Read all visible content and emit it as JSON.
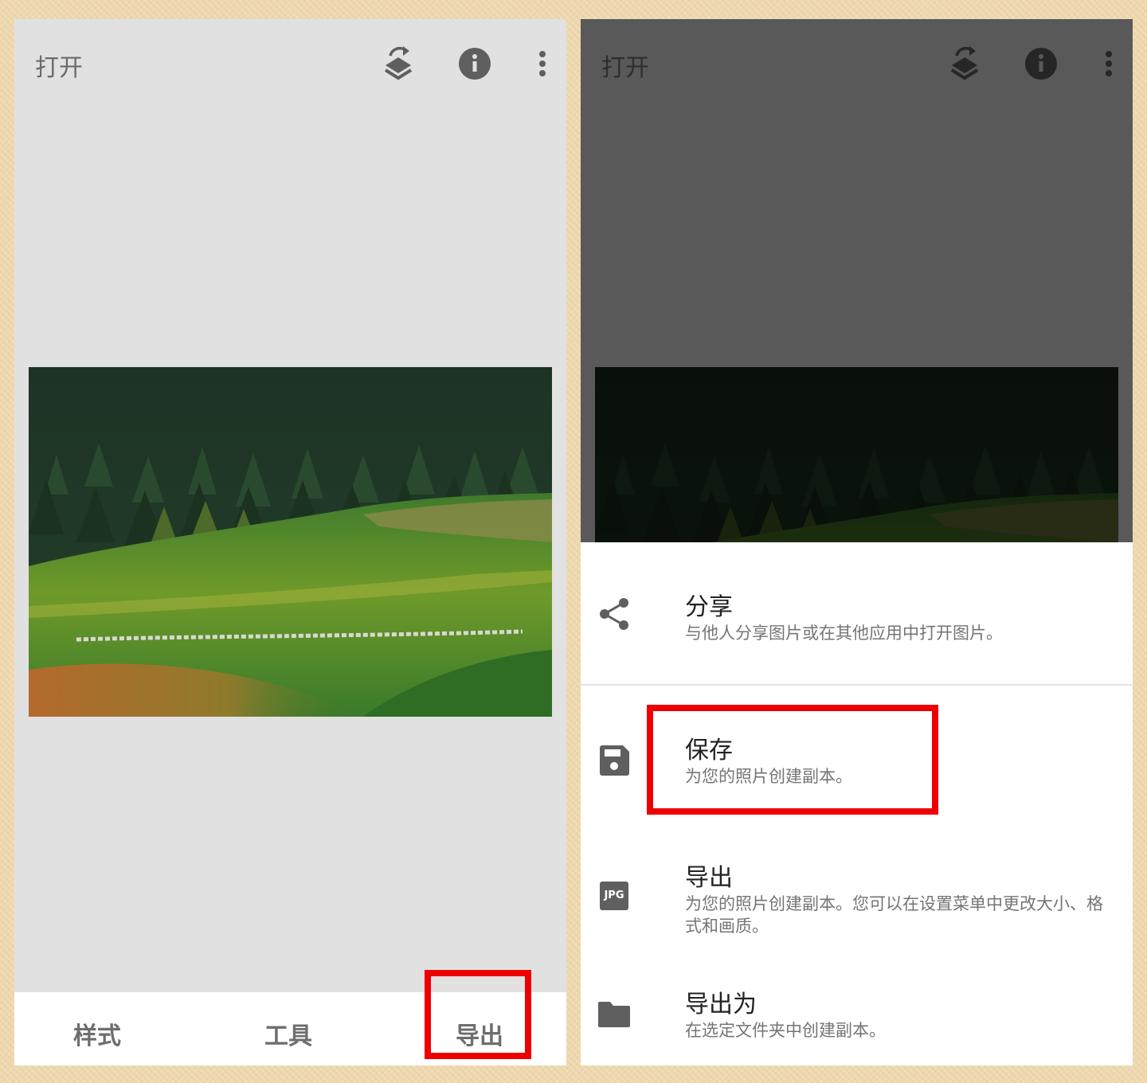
{
  "left_screen": {
    "header": {
      "open_label": "打开"
    },
    "icons": {
      "layers": "layers-undo-icon",
      "info": "info-icon",
      "more": "more-vert-icon"
    },
    "bottom_nav": {
      "styles": "样式",
      "tools": "工具",
      "export": "导出"
    }
  },
  "right_screen": {
    "header": {
      "open_label": "打开"
    },
    "export_menu": {
      "share": {
        "title": "分享",
        "desc": "与他人分享图片或在其他应用中打开图片。",
        "icon": "share-icon"
      },
      "save": {
        "title": "保存",
        "desc": "为您的照片创建副本。",
        "icon": "save-icon"
      },
      "export": {
        "title": "导出",
        "desc": "为您的照片创建副本。您可以在设置菜单中更改大小、格式和画质。",
        "badge": "JPG"
      },
      "export_as": {
        "title": "导出为",
        "desc": "在选定文件夹中创建副本。",
        "icon": "folder-icon"
      }
    }
  },
  "colors": {
    "highlight": "#ee0000",
    "icon_gray": "#5f5f5f",
    "dim_overlay": "#595959"
  }
}
